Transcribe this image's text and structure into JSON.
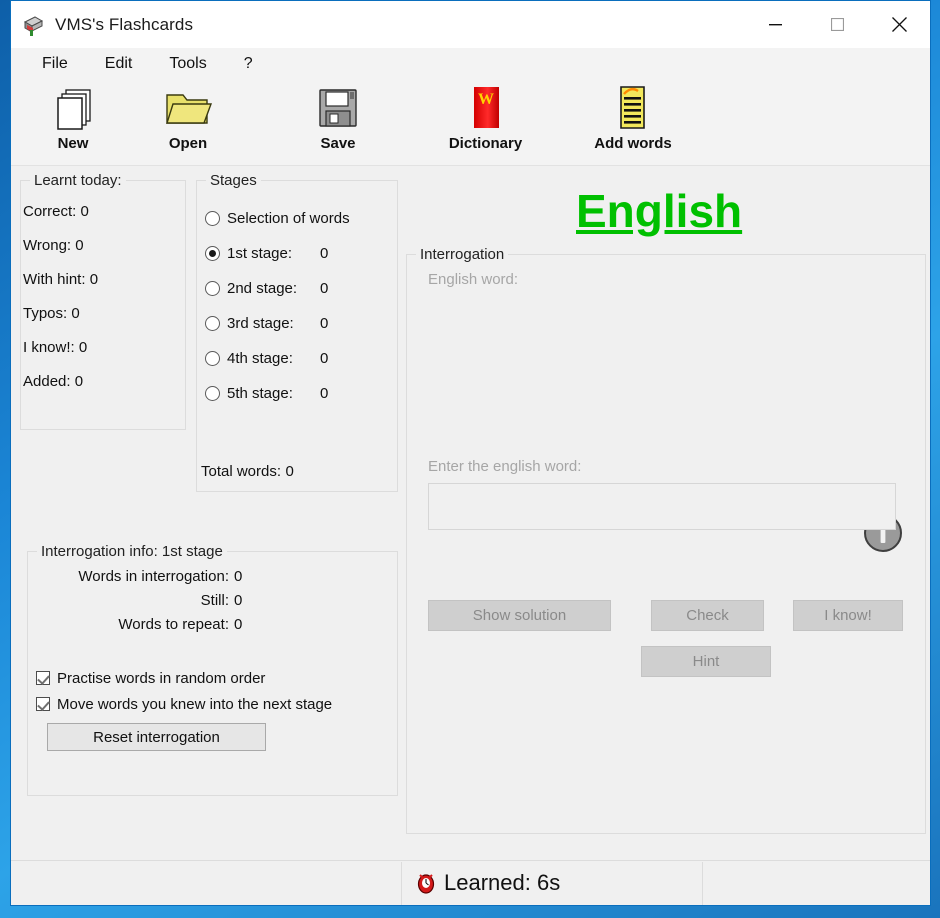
{
  "window": {
    "title": "VMS's Flashcards",
    "icon": "flashcard-app-icon",
    "minimize": "–",
    "maximize": "□",
    "close": "✕"
  },
  "menubar": {
    "items": [
      {
        "label": "File"
      },
      {
        "label": "Edit"
      },
      {
        "label": "Tools"
      },
      {
        "label": "?"
      }
    ]
  },
  "toolbar": {
    "items": [
      {
        "label": "New",
        "icon": "new-document-icon"
      },
      {
        "label": "Open",
        "icon": "open-folder-icon"
      },
      {
        "label": "Save",
        "icon": "floppy-disk-icon"
      },
      {
        "label": "Dictionary",
        "icon": "dictionary-book-icon"
      },
      {
        "label": "Add words",
        "icon": "add-words-note-icon"
      }
    ]
  },
  "learnt_today": {
    "title": "Learnt today:",
    "rows": [
      {
        "label": "Correct:",
        "value": "0"
      },
      {
        "label": "Wrong:",
        "value": "0"
      },
      {
        "label": "With hint:",
        "value": "0"
      },
      {
        "label": "Typos:",
        "value": "0"
      },
      {
        "label": "I know!:",
        "value": "0"
      },
      {
        "label": "Added:",
        "value": "0"
      }
    ]
  },
  "stages": {
    "title": "Stages",
    "options": [
      {
        "label": "Selection of words",
        "value": "",
        "selected": false
      },
      {
        "label": "1st stage:",
        "value": "0",
        "selected": true
      },
      {
        "label": "2nd stage:",
        "value": "0",
        "selected": false
      },
      {
        "label": "3rd stage:",
        "value": "0",
        "selected": false
      },
      {
        "label": "4th stage:",
        "value": "0",
        "selected": false
      },
      {
        "label": "5th stage:",
        "value": "0",
        "selected": false
      }
    ],
    "total_label": "Total words:",
    "total_value": "0"
  },
  "interrogation_info": {
    "title": "Interrogation info: 1st stage",
    "rows": [
      {
        "label": "Words in interrogation:",
        "value": "0"
      },
      {
        "label": "Still:",
        "value": "0"
      },
      {
        "label": "Words to repeat:",
        "value": "0"
      }
    ],
    "checkboxes": [
      {
        "label": "Practise words in random order",
        "checked": true
      },
      {
        "label": "Move words you knew into the next stage",
        "checked": true
      }
    ],
    "reset_button": "Reset interrogation"
  },
  "interrogation": {
    "language_title": "English",
    "group_title": "Interrogation",
    "word_label": "English word:",
    "word_value": "",
    "input_label": "Enter the english word:",
    "input_value": "",
    "input_placeholder": "",
    "info_icon": "info-circle-icon",
    "buttons": [
      {
        "label": "Show solution",
        "enabled": false
      },
      {
        "label": "Check",
        "enabled": false
      },
      {
        "label": "I know!",
        "enabled": false
      },
      {
        "label": "Hint",
        "enabled": false
      }
    ]
  },
  "statusbar": {
    "left_text": "",
    "icon": "alarm-clock-icon",
    "center_text": "Learned: 6s",
    "right_text": ""
  },
  "colors": {
    "accent_green": "#00c000",
    "window_bg": "#f0f0f0",
    "desktop_blue": "#1177c4"
  }
}
